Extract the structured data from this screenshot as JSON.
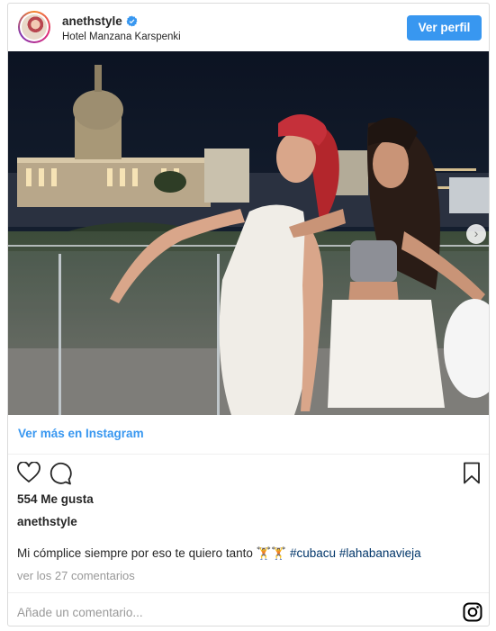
{
  "header": {
    "username": "anethstyle",
    "location": "Hotel Manzana Karspenki",
    "profile_button": "Ver perfil"
  },
  "post": {
    "view_more": "Ver más en Instagram",
    "likes": "554 Me gusta",
    "caption_user": "anethstyle",
    "caption_text": "Mi cómplice siempre por eso te quiero tanto 🏋️🏋️",
    "hashtags": [
      "#cubacu",
      "#lahabanavieja"
    ],
    "comments_link": "ver los 27 comentarios",
    "add_comment_placeholder": "Añade un comentario..."
  },
  "colors": {
    "accent": "#3897f0",
    "text": "#262626",
    "muted": "#999999",
    "hashtag": "#003569"
  },
  "icons": [
    "verified-badge-icon",
    "heart-icon",
    "comment-icon",
    "bookmark-icon",
    "chevron-right-icon",
    "instagram-logo-icon"
  ]
}
